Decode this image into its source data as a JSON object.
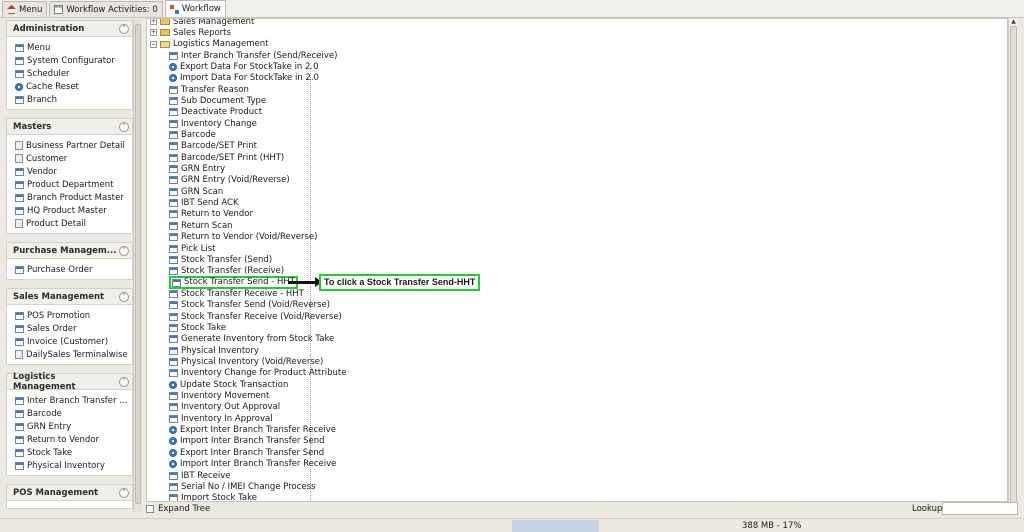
{
  "tabs": [
    {
      "label": "Menu",
      "icon": "house-icon"
    },
    {
      "label": "Workflow Activities: 0",
      "icon": "calendar-icon"
    },
    {
      "label": "Workflow",
      "icon": "workflow-icon"
    }
  ],
  "sidebar": {
    "panels": [
      {
        "title": "Administration",
        "items": [
          {
            "label": "Menu",
            "icon": "form"
          },
          {
            "label": "System Configurator",
            "icon": "form"
          },
          {
            "label": "Scheduler",
            "icon": "form"
          },
          {
            "label": "Cache Reset",
            "icon": "gear"
          },
          {
            "label": "Branch",
            "icon": "form"
          }
        ]
      },
      {
        "title": "Masters",
        "items": [
          {
            "label": "Business Partner Detail",
            "icon": "doc"
          },
          {
            "label": "Customer",
            "icon": "doc"
          },
          {
            "label": "Vendor",
            "icon": "form"
          },
          {
            "label": "Product Department",
            "icon": "form"
          },
          {
            "label": "Branch Product Master",
            "icon": "form"
          },
          {
            "label": "HQ Product Master",
            "icon": "form"
          },
          {
            "label": "Product Detail",
            "icon": "doc"
          }
        ]
      },
      {
        "title": "Purchase Managem...",
        "items": [
          {
            "label": "Purchase Order",
            "icon": "form"
          }
        ]
      },
      {
        "title": "Sales Management",
        "items": [
          {
            "label": "POS Promotion",
            "icon": "form"
          },
          {
            "label": "Sales Order",
            "icon": "form"
          },
          {
            "label": "Invoice (Customer)",
            "icon": "form"
          },
          {
            "label": "DailySales Terminalwise",
            "icon": "doc"
          }
        ]
      },
      {
        "title": "Logistics Management",
        "items": [
          {
            "label": "Inter Branch Transfer ...",
            "icon": "form"
          },
          {
            "label": "Barcode",
            "icon": "form"
          },
          {
            "label": "GRN Entry",
            "icon": "form"
          },
          {
            "label": "Return to Vendor",
            "icon": "form"
          },
          {
            "label": "Stock Take",
            "icon": "form"
          },
          {
            "label": "Physical Inventory",
            "icon": "form"
          }
        ]
      },
      {
        "title": "POS Management",
        "items": []
      }
    ]
  },
  "tree": {
    "folders": [
      {
        "label": "Sales Management",
        "state": "collapsed"
      },
      {
        "label": "Sales Reports",
        "state": "collapsed"
      },
      {
        "label": "Logistics Management",
        "state": "expanded"
      }
    ],
    "items": [
      {
        "label": "Inter Branch Transfer (Send/Receive)",
        "icon": "form"
      },
      {
        "label": "Export Data For StockTake in 2.0",
        "icon": "gear"
      },
      {
        "label": "Import Data For StockTake in 2.0",
        "icon": "gear"
      },
      {
        "label": "Transfer Reason",
        "icon": "form"
      },
      {
        "label": "Sub Document Type",
        "icon": "form"
      },
      {
        "label": "Deactivate Product",
        "icon": "form"
      },
      {
        "label": "Inventory Change",
        "icon": "form"
      },
      {
        "label": "Barcode",
        "icon": "form"
      },
      {
        "label": "Barcode/SET Print",
        "icon": "form"
      },
      {
        "label": "Barcode/SET Print (HHT)",
        "icon": "form"
      },
      {
        "label": "GRN Entry",
        "icon": "form"
      },
      {
        "label": "GRN Entry (Void/Reverse)",
        "icon": "form"
      },
      {
        "label": "GRN Scan",
        "icon": "form"
      },
      {
        "label": "IBT Send ACK",
        "icon": "form"
      },
      {
        "label": "Return to Vendor",
        "icon": "form"
      },
      {
        "label": "Return Scan",
        "icon": "form"
      },
      {
        "label": "Return to Vendor (Void/Reverse)",
        "icon": "form"
      },
      {
        "label": "Pick List",
        "icon": "form"
      },
      {
        "label": "Stock Transfer (Send)",
        "icon": "form"
      },
      {
        "label": "Stock Transfer (Receive)",
        "icon": "form"
      },
      {
        "label": "Stock Transfer Send - HHT",
        "icon": "form",
        "highlighted": true
      },
      {
        "label": "Stock Transfer Receive - HHT",
        "icon": "form"
      },
      {
        "label": "Stock Transfer Send (Void/Reverse)",
        "icon": "form"
      },
      {
        "label": "Stock Transfer Receive (Void/Reverse)",
        "icon": "form"
      },
      {
        "label": "Stock Take",
        "icon": "form"
      },
      {
        "label": "Generate Inventory from Stock Take",
        "icon": "form"
      },
      {
        "label": "Physical Inventory",
        "icon": "form"
      },
      {
        "label": "Physical Inventory (Void/Reverse)",
        "icon": "form"
      },
      {
        "label": "Inventory Change for Product Attribute",
        "icon": "form"
      },
      {
        "label": "Update Stock Transaction",
        "icon": "gear"
      },
      {
        "label": "Inventory Movement",
        "icon": "form"
      },
      {
        "label": "Inventory Out Approval",
        "icon": "form"
      },
      {
        "label": "Inventory In Approval",
        "icon": "form"
      },
      {
        "label": "Export Inter Branch Transfer Receive",
        "icon": "gear"
      },
      {
        "label": "Import Inter Branch Transfer Send",
        "icon": "gear"
      },
      {
        "label": "Export Inter Branch Transfer Send",
        "icon": "gear"
      },
      {
        "label": "Import Inter Branch Transfer Receive",
        "icon": "gear"
      },
      {
        "label": "IBT Receive",
        "icon": "form"
      },
      {
        "label": "Serial No / IMEI Change Process",
        "icon": "form"
      },
      {
        "label": "Import Stock Take",
        "icon": "form"
      }
    ]
  },
  "annotation": {
    "text": "To click a Stock Transfer Send-HHT",
    "color": "#22cc33"
  },
  "bottom": {
    "expand_tree_label": "Expand Tree",
    "lookup_label": "Lookup",
    "lookup_value": ""
  },
  "status": {
    "memory": "388 MB - 17%"
  }
}
